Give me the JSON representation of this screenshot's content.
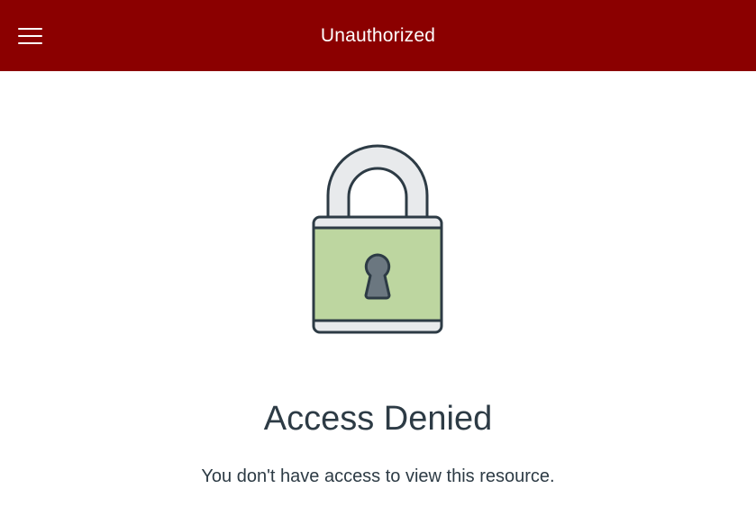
{
  "header": {
    "title": "Unauthorized",
    "menu_icon": "hamburger-menu-icon",
    "background_color": "#8b0000"
  },
  "main": {
    "illustration_icon": "padlock-icon",
    "heading": "Access Denied",
    "message": "You don't have access to view this resource."
  },
  "colors": {
    "lock_body": "#bdd6a0",
    "lock_shackle": "#e8eaec",
    "lock_outline": "#2d3b45",
    "keyhole": "#6b7780",
    "text": "#2d3b45"
  }
}
